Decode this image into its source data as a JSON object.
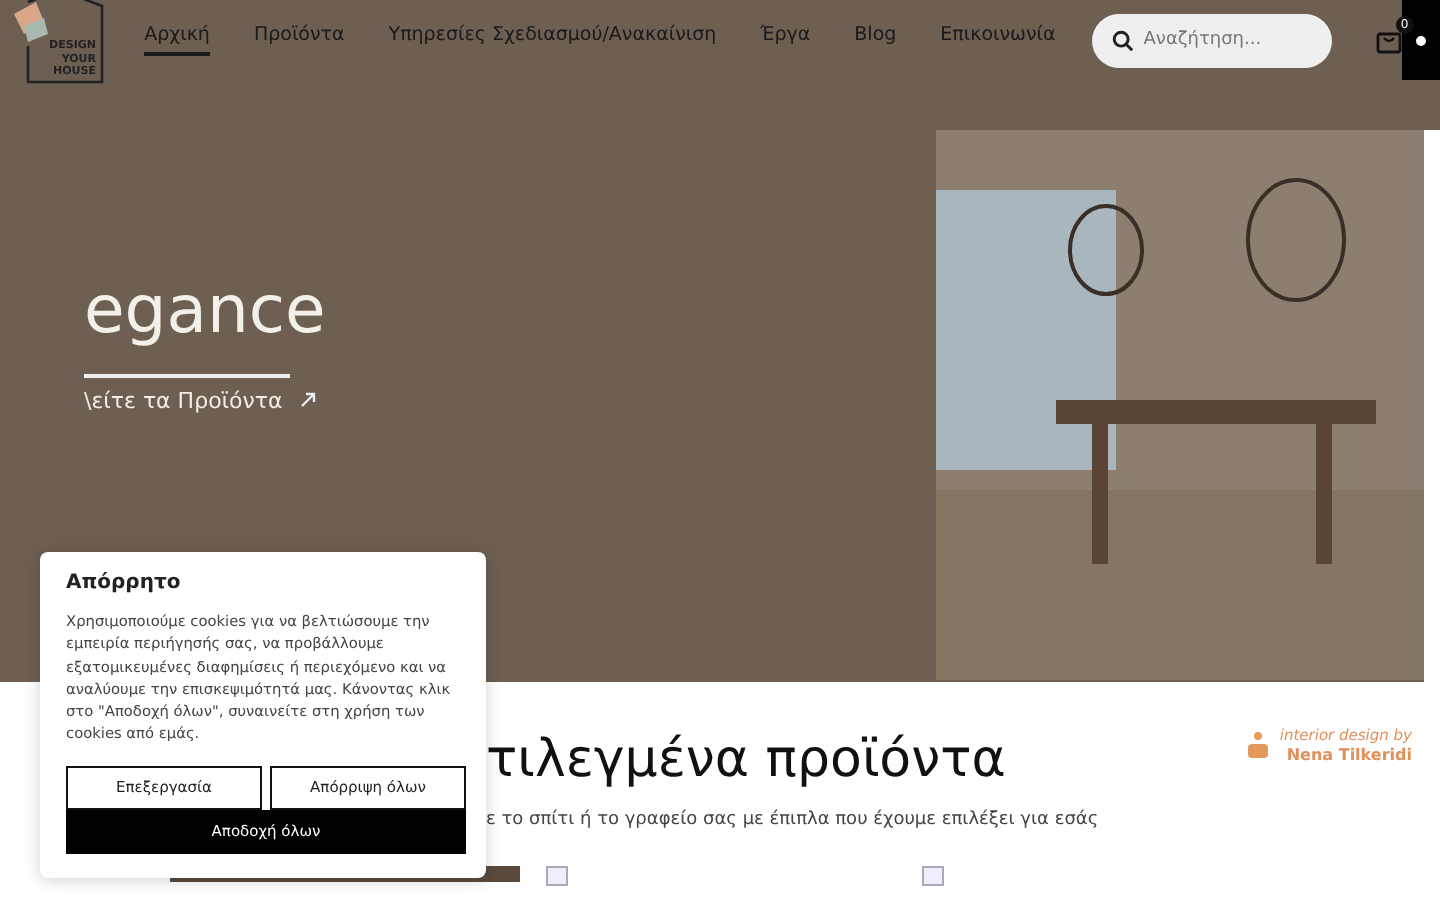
{
  "header": {
    "logo_text": [
      "DESIGN",
      "YOUR",
      "HOUSE"
    ],
    "nav": [
      {
        "label": "Αρχική",
        "selected": true
      },
      {
        "label": "Προϊόντα",
        "selected": false
      },
      {
        "label": "Υπηρεσίες Σχεδιασμού/Ανακαίνιση",
        "selected": false
      },
      {
        "label": "Έργα",
        "selected": false
      },
      {
        "label": "Blog",
        "selected": false
      },
      {
        "label": "Επικοινωνία",
        "selected": false
      }
    ],
    "search": {
      "placeholder": "Αναζήτηση..."
    },
    "cart_count": "0"
  },
  "hero": {
    "title": "egance",
    "link": "\\είτε τα Προϊόντα"
  },
  "featured": {
    "title": "τιλεγμένα προϊόντα",
    "subtitle": "ε το σπίτι ή το γραφείο σας με έπιπλα που έχουμε επιλέξει για εσάς",
    "badge": [
      "interior design by",
      "Nena Tilkeridi"
    ]
  },
  "cookie": {
    "title": "Απόρρητο",
    "text": "Χρησιμοποιούμε cookies για να βελτιώσουμε την εμπειρία περιήγησής σας, να προβάλλουμε εξατομικευμένες διαφημίσεις ή περιεχόμενο και να αναλύουμε την επισκεψιμότητά μας. Κάνοντας κλικ στο \"Αποδοχή όλων\", συναινείτε στη χρήση των cookies από εμάς.",
    "buttons": [
      {
        "label": "Επεξεργασία",
        "kind": "outline"
      },
      {
        "label": "Απόρριψη όλων",
        "kind": "outline"
      },
      {
        "label": "Αποδοχή όλων",
        "kind": "solid"
      }
    ]
  }
}
